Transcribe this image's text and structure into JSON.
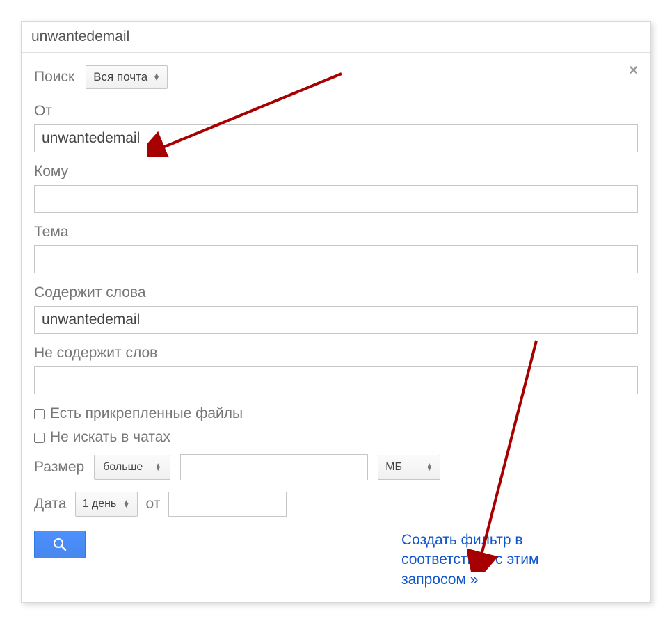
{
  "topbar": {
    "title": "unwantedemail"
  },
  "closeGlyph": "×",
  "searchRow": {
    "label": "Поиск",
    "dropdown": "Вся почта"
  },
  "fields": {
    "from": {
      "label": "От",
      "value": "unwantedemail"
    },
    "to": {
      "label": "Кому",
      "value": ""
    },
    "subject": {
      "label": "Тема",
      "value": ""
    },
    "hasWords": {
      "label": "Содержит слова",
      "value": "unwantedemail"
    },
    "doesntHave": {
      "label": "Не содержит слов",
      "value": ""
    }
  },
  "checkboxes": {
    "hasAttachment": "Есть прикрепленные файлы",
    "skipChats": "Не искать в чатах"
  },
  "size": {
    "label": "Размер",
    "operator": "больше",
    "value": "",
    "unit": "МБ"
  },
  "date": {
    "label": "Дата",
    "range": "1 день",
    "fromLabel": "от",
    "value": ""
  },
  "createFilterLink": "Создать фильтр в соответствии с этим запросом »"
}
